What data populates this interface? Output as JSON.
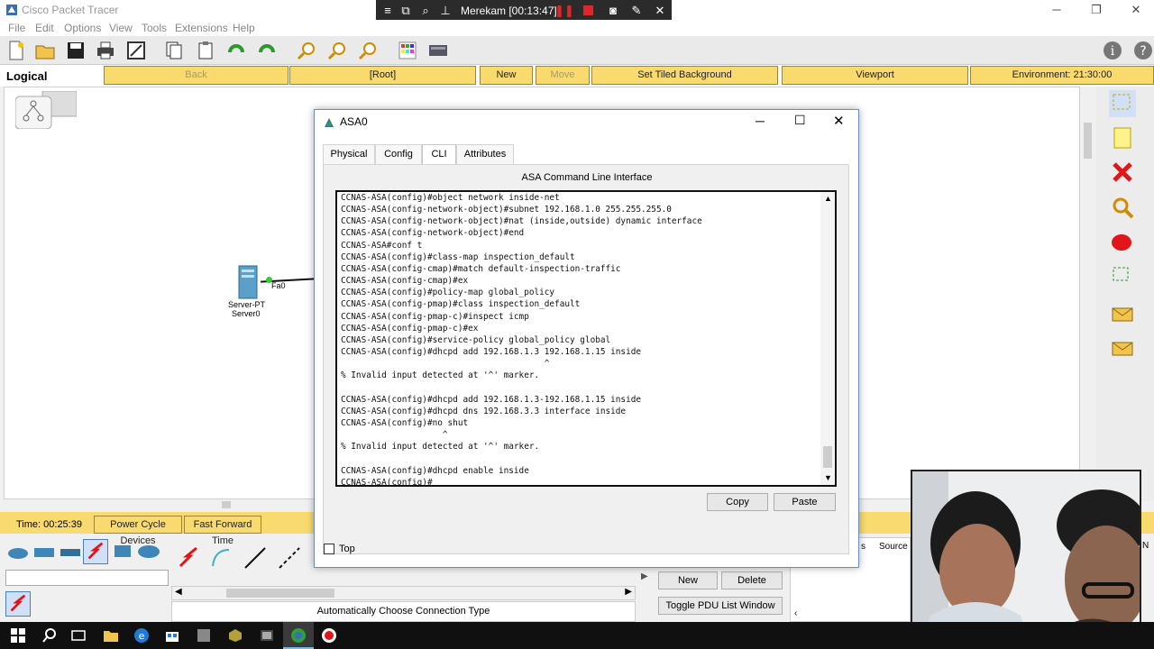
{
  "app": {
    "title": "Cisco Packet Tracer",
    "window_controls": [
      "─",
      "❐",
      "✕"
    ]
  },
  "recorder": {
    "label": "Merekam [00:13:47]"
  },
  "menu": {
    "items": [
      "File",
      "Edit",
      "Options",
      "View",
      "Tools",
      "Extensions",
      "Help"
    ]
  },
  "logical_bar": {
    "title": "Logical",
    "back": "Back",
    "root": "[Root]",
    "new_cluster": "New Cluster",
    "move_object": "Move Object",
    "set_tiled_background": "Set Tiled Background",
    "viewport": "Viewport",
    "environment": "Environment: 21:30:00"
  },
  "workspace": {
    "device_type": "Server-PT",
    "device_name": "Server0",
    "port_label": "Fa0"
  },
  "status": {
    "time": "Time: 00:25:39",
    "power_cycle": "Power Cycle Devices",
    "fast_forward": "Fast Forward Time"
  },
  "bottom": {
    "connection_label": "Automatically Choose Connection Type",
    "new_btn": "New",
    "delete_btn": "Delete",
    "toggle_pdu": "Toggle PDU List Window",
    "s_col": "s",
    "source_col": "Source",
    "n_col": "N"
  },
  "dialog": {
    "title": "ASA0",
    "tabs": [
      "Physical",
      "Config",
      "CLI",
      "Attributes"
    ],
    "active_tab": "CLI",
    "cli_header": "ASA Command Line Interface",
    "copy": "Copy",
    "paste": "Paste",
    "top_label": "Top",
    "cli_lines": [
      "CCNAS-ASA(config)#object network inside-net",
      "CCNAS-ASA(config-network-object)#subnet 192.168.1.0 255.255.255.0",
      "CCNAS-ASA(config-network-object)#nat (inside,outside) dynamic interface",
      "CCNAS-ASA(config-network-object)#end",
      "CCNAS-ASA#conf t",
      "CCNAS-ASA(config)#class-map inspection_default",
      "CCNAS-ASA(config-cmap)#match default-inspection-traffic",
      "CCNAS-ASA(config-cmap)#ex",
      "CCNAS-ASA(config)#policy-map global_policy",
      "CCNAS-ASA(config-pmap)#class inspection_default",
      "CCNAS-ASA(config-pmap-c)#inspect icmp",
      "CCNAS-ASA(config-pmap-c)#ex",
      "CCNAS-ASA(config)#service-policy global_policy global",
      "CCNAS-ASA(config)#dhcpd add 192.168.1.3 192.168.1.15 inside",
      "                                        ^",
      "% Invalid input detected at '^' marker.",
      "",
      "CCNAS-ASA(config)#dhcpd add 192.168.1.3-192.168.1.15 inside",
      "CCNAS-ASA(config)#dhcpd dns 192.168.3.3 interface inside",
      "CCNAS-ASA(config)#no shut",
      "                    ^",
      "% Invalid input detected at '^' marker.",
      "",
      "CCNAS-ASA(config)#dhcpd enable inside",
      "CCNAS-ASA(config)#"
    ]
  },
  "colors": {
    "yellow_button": "#f8da6e",
    "toolbar_bg": "#eaeaea",
    "taskbar": "#101010",
    "recorder_bg": "#2b2b2b",
    "dialog_border": "#6a8cc7"
  }
}
